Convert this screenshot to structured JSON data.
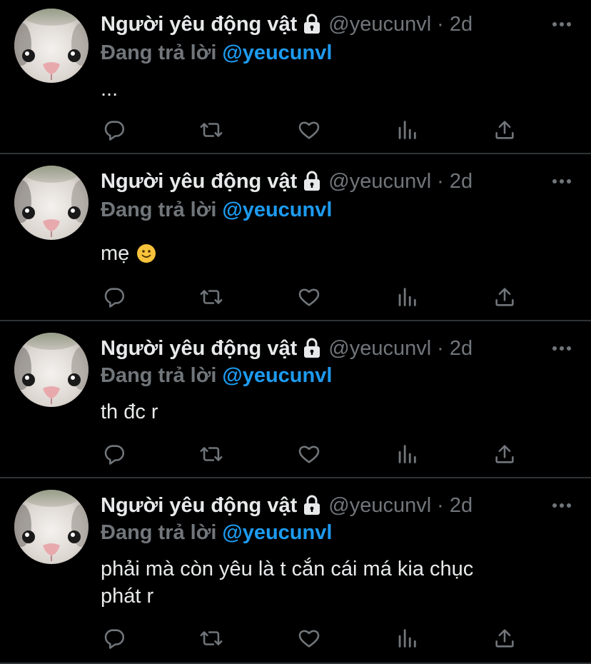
{
  "tweets": [
    {
      "display_name": "Người yêu động vật",
      "handle": "@yeucunvl",
      "dot": "·",
      "time": "2d",
      "reply_label": "Đang trả lời",
      "reply_handle": "@yeucunvl",
      "text": "...",
      "emoji": ""
    },
    {
      "display_name": "Người yêu động vật",
      "handle": "@yeucunvl",
      "dot": "·",
      "time": "2d",
      "reply_label": "Đang trả lời",
      "reply_handle": "@yeucunvl",
      "text": "mẹ",
      "emoji": "slightly-smiling-face-emoji"
    },
    {
      "display_name": "Người yêu động vật",
      "handle": "@yeucunvl",
      "dot": "·",
      "time": "2d",
      "reply_label": "Đang trả lời",
      "reply_handle": "@yeucunvl",
      "text": "th đc r",
      "emoji": ""
    },
    {
      "display_name": "Người yêu động vật",
      "handle": "@yeucunvl",
      "dot": "·",
      "time": "2d",
      "reply_label": "Đang trả lời",
      "reply_handle": "@yeucunvl",
      "text_lines": [
        "phải mà còn yêu là t cắn cái má kia chục",
        "phát r"
      ],
      "emoji": ""
    }
  ],
  "icons": {
    "lock": "lock-icon",
    "more": "more-options-icon",
    "reply": "reply-icon",
    "retweet": "retweet-icon",
    "like": "like-heart-icon",
    "analytics": "analytics-icon",
    "share": "share-icon",
    "avatar": "cat-avatar"
  },
  "colors": {
    "background": "#000000",
    "text": "#e7e9ea",
    "muted": "#71767b",
    "accent": "#1d9bf0",
    "divider": "#2f3336"
  }
}
